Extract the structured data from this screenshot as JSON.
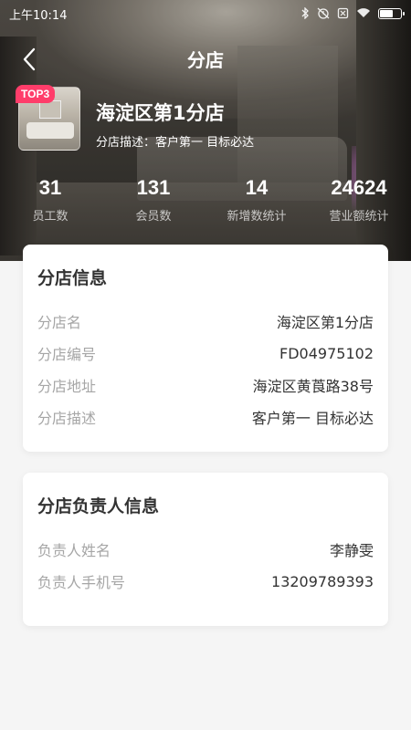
{
  "status_bar": {
    "time": "上午10:14",
    "icons": [
      "bluetooth-icon",
      "alarm-off-icon",
      "sim-off-icon",
      "wifi-icon",
      "battery-icon"
    ]
  },
  "nav": {
    "title": "分店",
    "back_icon": "chevron-left-icon"
  },
  "branch": {
    "badge": "TOP3",
    "name": "海淀区第1分店",
    "description": "分店描述：客户第一 目标必达"
  },
  "stats": [
    {
      "value": "31",
      "label": "员工数"
    },
    {
      "value": "131",
      "label": "会员数"
    },
    {
      "value": "14",
      "label": "新增数统计"
    },
    {
      "value": "24624",
      "label": "营业额统计"
    }
  ],
  "branch_info": {
    "title": "分店信息",
    "rows": [
      {
        "label": "分店名",
        "value": "海淀区第1分店"
      },
      {
        "label": "分店编号",
        "value": "FD04975102"
      },
      {
        "label": "分店地址",
        "value": "海淀区黄莨路38号"
      },
      {
        "label": "分店描述",
        "value": "客户第一 目标必达"
      }
    ]
  },
  "manager_info": {
    "title": "分店负责人信息",
    "rows": [
      {
        "label": "负责人姓名",
        "value": "李静雯"
      },
      {
        "label": "负责人手机号",
        "value": "13209789393"
      }
    ]
  },
  "colors": {
    "badge": "#ff3d6a",
    "background": "#f5f5f5",
    "label": "#a6a6a6",
    "text": "#333333"
  }
}
